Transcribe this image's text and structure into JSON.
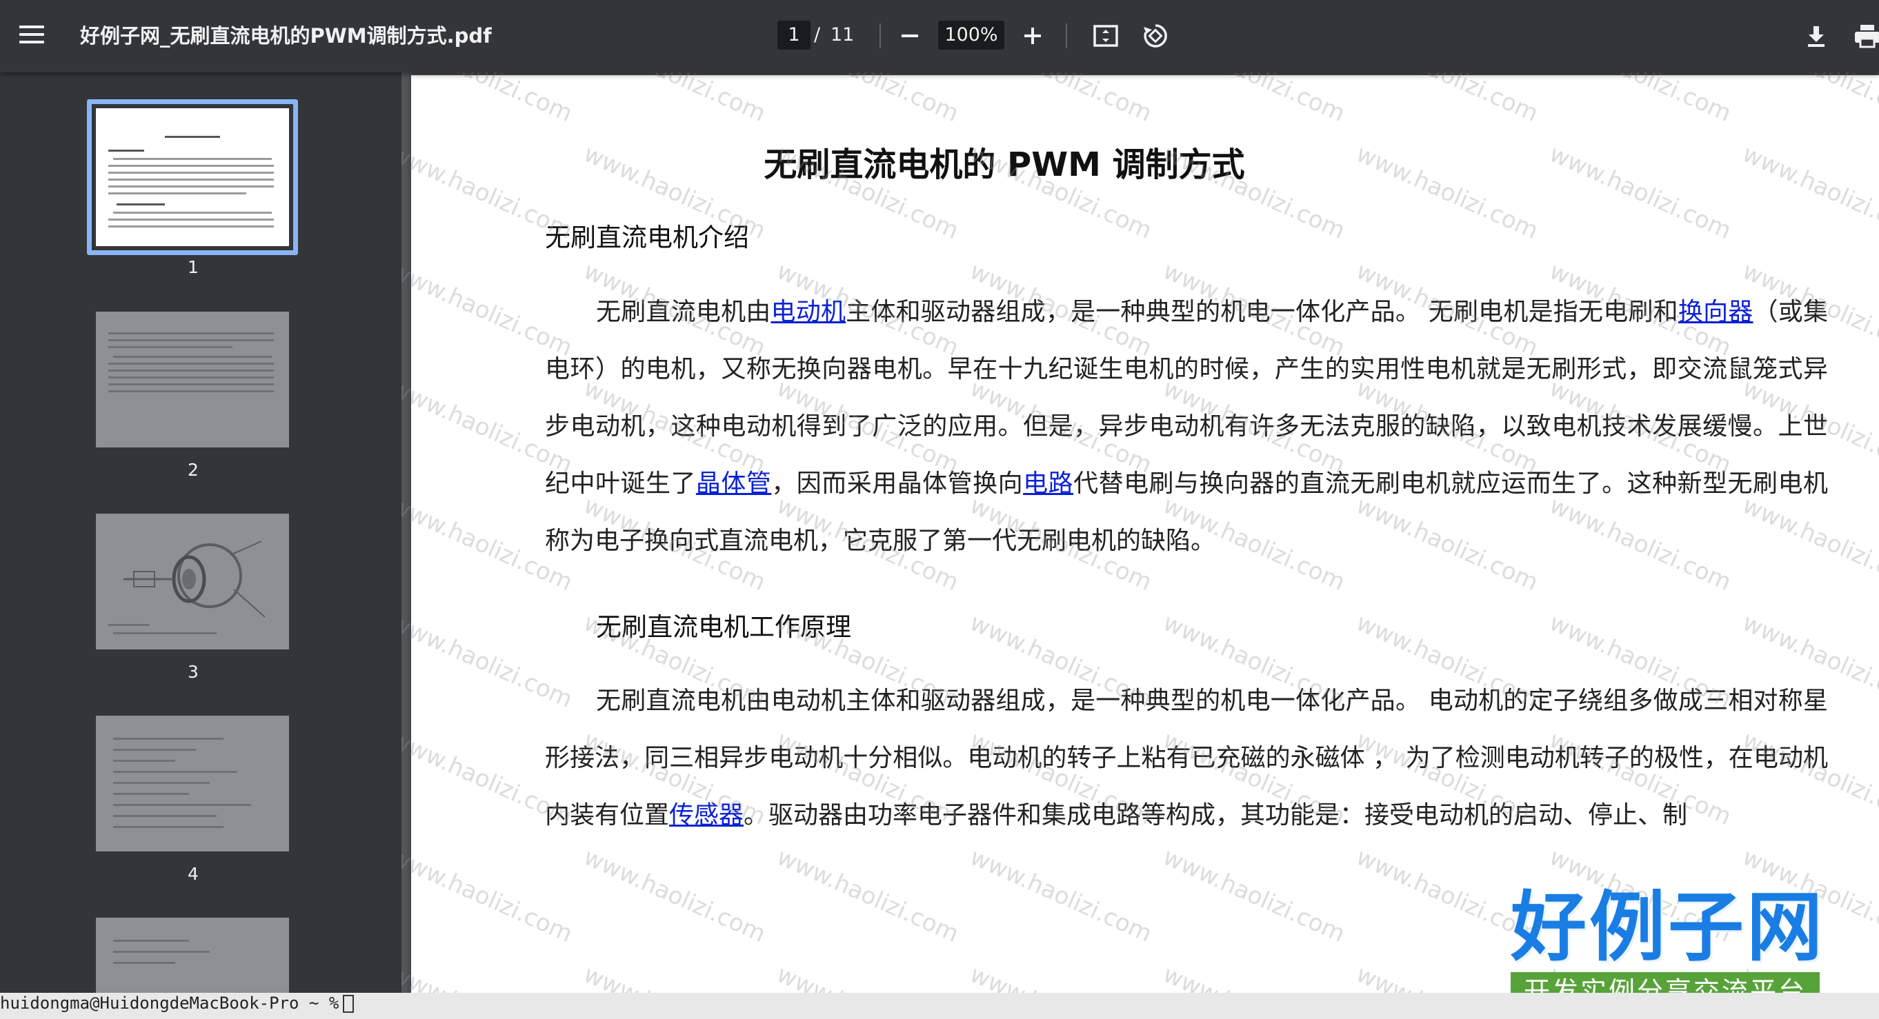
{
  "toolbar": {
    "title": "好例子网_无刷直流电机的PWM调制方式.pdf",
    "page_current": "1",
    "page_separator": "/",
    "page_total": "11",
    "zoom": "100%",
    "icons": [
      "menu-icon",
      "minus-icon",
      "plus-icon",
      "fit-page-icon",
      "rotate-icon",
      "download-icon",
      "print-icon"
    ]
  },
  "thumbnails": [
    {
      "label": "1",
      "selected": true
    },
    {
      "label": "2",
      "selected": false
    },
    {
      "label": "3",
      "selected": false
    },
    {
      "label": "4",
      "selected": false
    }
  ],
  "document": {
    "title": "无刷直流电机的 PWM 调制方式",
    "section1_heading": "无刷直流电机介绍",
    "para1": {
      "t1": "无刷直流电机由",
      "link1": "电动机",
      "t2": "主体和驱动器组成，是一种典型的机电一体化产品。 无刷电机是指无电刷和",
      "link2": "换向器",
      "t3": "（或集电环）的电机，又称无换向器电机。早在十九纪诞生电机的时候，产生的实用性电机就是无刷形式，即交流鼠笼式异步电动机，这种电动机得到了广泛的应用。但是，异步电动机有许多无法克服的缺陷，以致电机技术发展缓慢。上世纪中叶诞生了",
      "link3": "晶体管",
      "t4": "，因而采用晶体管换向",
      "link4": "电路",
      "t5": "代替电刷与换向器的直流无刷电机就应运而生了。这种新型无刷电机称为电子换向式直流电机，它克服了第一代无刷电机的缺陷。"
    },
    "section2_heading": "无刷直流电机工作原理",
    "para2": {
      "t1": "无刷直流电机由电动机主体和驱动器组成，是一种典型的机电一体化产品。 电动机的定子绕组多做成三相对称星形接法，同三相异步电动机十分相似。电动机的转子上粘有已充磁的永磁体 ， 为了检测电动机转子的极性，在电动机内装有位置",
      "link1": "传感器",
      "t2": "。驱动器由功率电子器件和集成电路等构成，其功能是：接受电动机的启动、停止、制"
    },
    "watermark": "www.haolizi.com",
    "logo_main": "好例子网",
    "logo_sub": "开发实例分享交流平台"
  },
  "terminal": {
    "prompt": "huidongma@HuidongdeMacBook-Pro ~ %"
  },
  "colors": {
    "toolbar_bg": "#323639",
    "viewer_bg": "#525659",
    "link": "#0b21d6",
    "thumb_selected": "#8ab4f8",
    "logo_blue": "#1a7de3",
    "logo_green": "#57a33a"
  }
}
